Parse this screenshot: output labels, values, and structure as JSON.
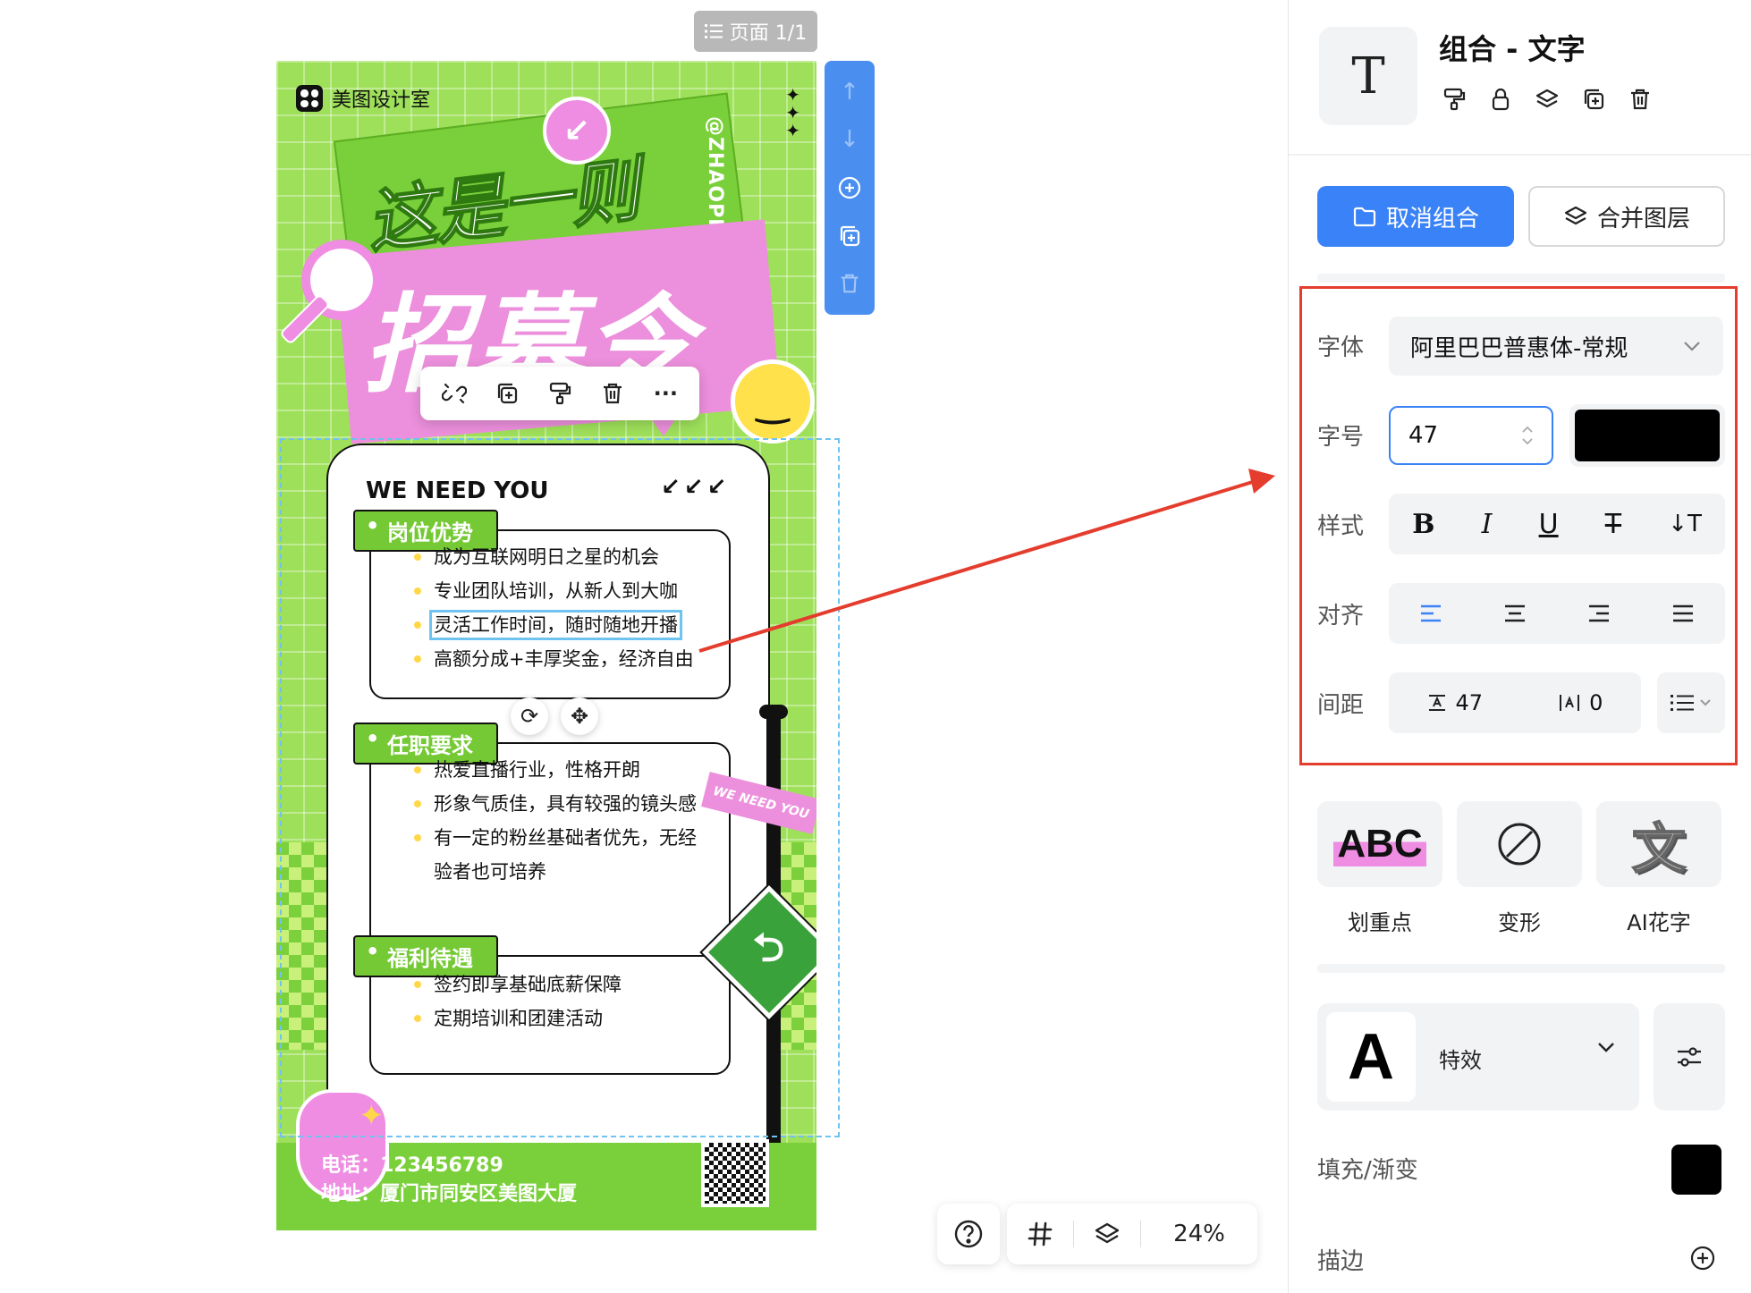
{
  "canvas": {
    "page_indicator": "页面 1/1",
    "zoom": "24%"
  },
  "poster": {
    "brand": "美图设计室",
    "title_line1": "这是一则",
    "title_line2": "招募令",
    "handle": "@ZHAOPIN",
    "card_heading": "WE NEED YOU",
    "card_arrows": "↙↙↙",
    "flag_text": "WE NEED YOU",
    "sections": [
      {
        "tag": "岗位优势",
        "items": [
          "成为互联网明日之星的机会",
          "专业团队培训，从新人到大咖",
          "灵活工作时间，随时随地开播",
          "高额分成+丰厚奖金，经济自由"
        ]
      },
      {
        "tag": "任职要求",
        "items": [
          "热爱直播行业，性格开朗",
          "形象气质佳，具有较强的镜头感",
          "有一定的粉丝基础者优先，无经",
          "验者也可培养"
        ]
      },
      {
        "tag": "福利待遇",
        "items": [
          "签约即享基础底薪保障",
          "定期培训和团建活动"
        ]
      }
    ],
    "phone": "电话：123456789",
    "address": "地址：厦门市同安区美图大厦"
  },
  "panel": {
    "title": "组合 - 文字",
    "ungroup_label": "取消组合",
    "merge_label": "合并图层",
    "font_label": "字体",
    "font_value": "阿里巴巴普惠体-常规",
    "size_label": "字号",
    "size_value": "47",
    "text_color": "#000000",
    "style_label": "样式",
    "align_label": "对齐",
    "spacing_label": "间距",
    "line_spacing": "47",
    "letter_spacing": "0",
    "effects": [
      {
        "label": "划重点",
        "preview": "ABC",
        "icon": "highlight-icon"
      },
      {
        "label": "变形",
        "icon": "prohibited-icon"
      },
      {
        "label": "AI花字",
        "preview": "文",
        "icon": "ai-text-icon"
      }
    ],
    "effect_preview": "A",
    "effect_name": "特效",
    "fill_label": "填充/渐变",
    "fill_color": "#000000",
    "stroke_label": "描边"
  },
  "colors": {
    "accent": "#3a82f7",
    "poster_green": "#9ee05a",
    "poster_pink": "#ec8fdc",
    "annotation_red": "#e43d2e"
  }
}
